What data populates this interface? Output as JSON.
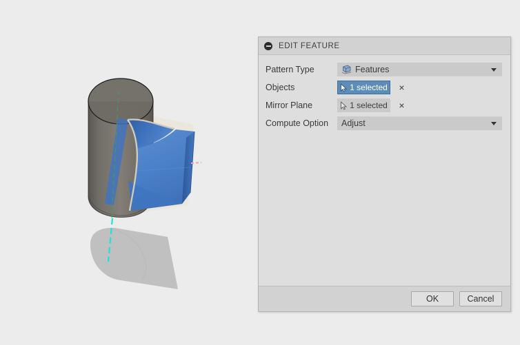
{
  "viewport": {
    "name": "3d-model-viewport",
    "background_color": "#ececec",
    "model_description": "Translucent gray cylinder with blue mirrored curved surface, beige reference plane, cyan dashed axis and gray ground shadow",
    "colors": {
      "cylinder": "#6e6a63",
      "blue_surface": "#4a80c8",
      "beige_plane": "#ede8de",
      "shadow": "#bfbfbf",
      "axis_cyan": "#19e6e0",
      "axis_green": "#3aa85c",
      "axis_red": "#f0a7a7"
    }
  },
  "dialog": {
    "title": "EDIT FEATURE",
    "collapse_icon": "minus-circle-icon",
    "rows": [
      {
        "label": "Pattern Type",
        "type": "dropdown",
        "value": "Features",
        "icon": "features-solid-icon"
      },
      {
        "label": "Objects",
        "type": "selection",
        "value": "1 selected",
        "icon": "cursor-arrow-icon",
        "state": "active",
        "clear": "×"
      },
      {
        "label": "Mirror Plane",
        "type": "selection",
        "value": "1 selected",
        "icon": "cursor-arrow-icon",
        "state": "inactive",
        "clear": "×"
      },
      {
        "label": "Compute Option",
        "type": "dropdown",
        "value": "Adjust"
      }
    ],
    "footer": {
      "ok_label": "OK",
      "cancel_label": "Cancel"
    }
  }
}
